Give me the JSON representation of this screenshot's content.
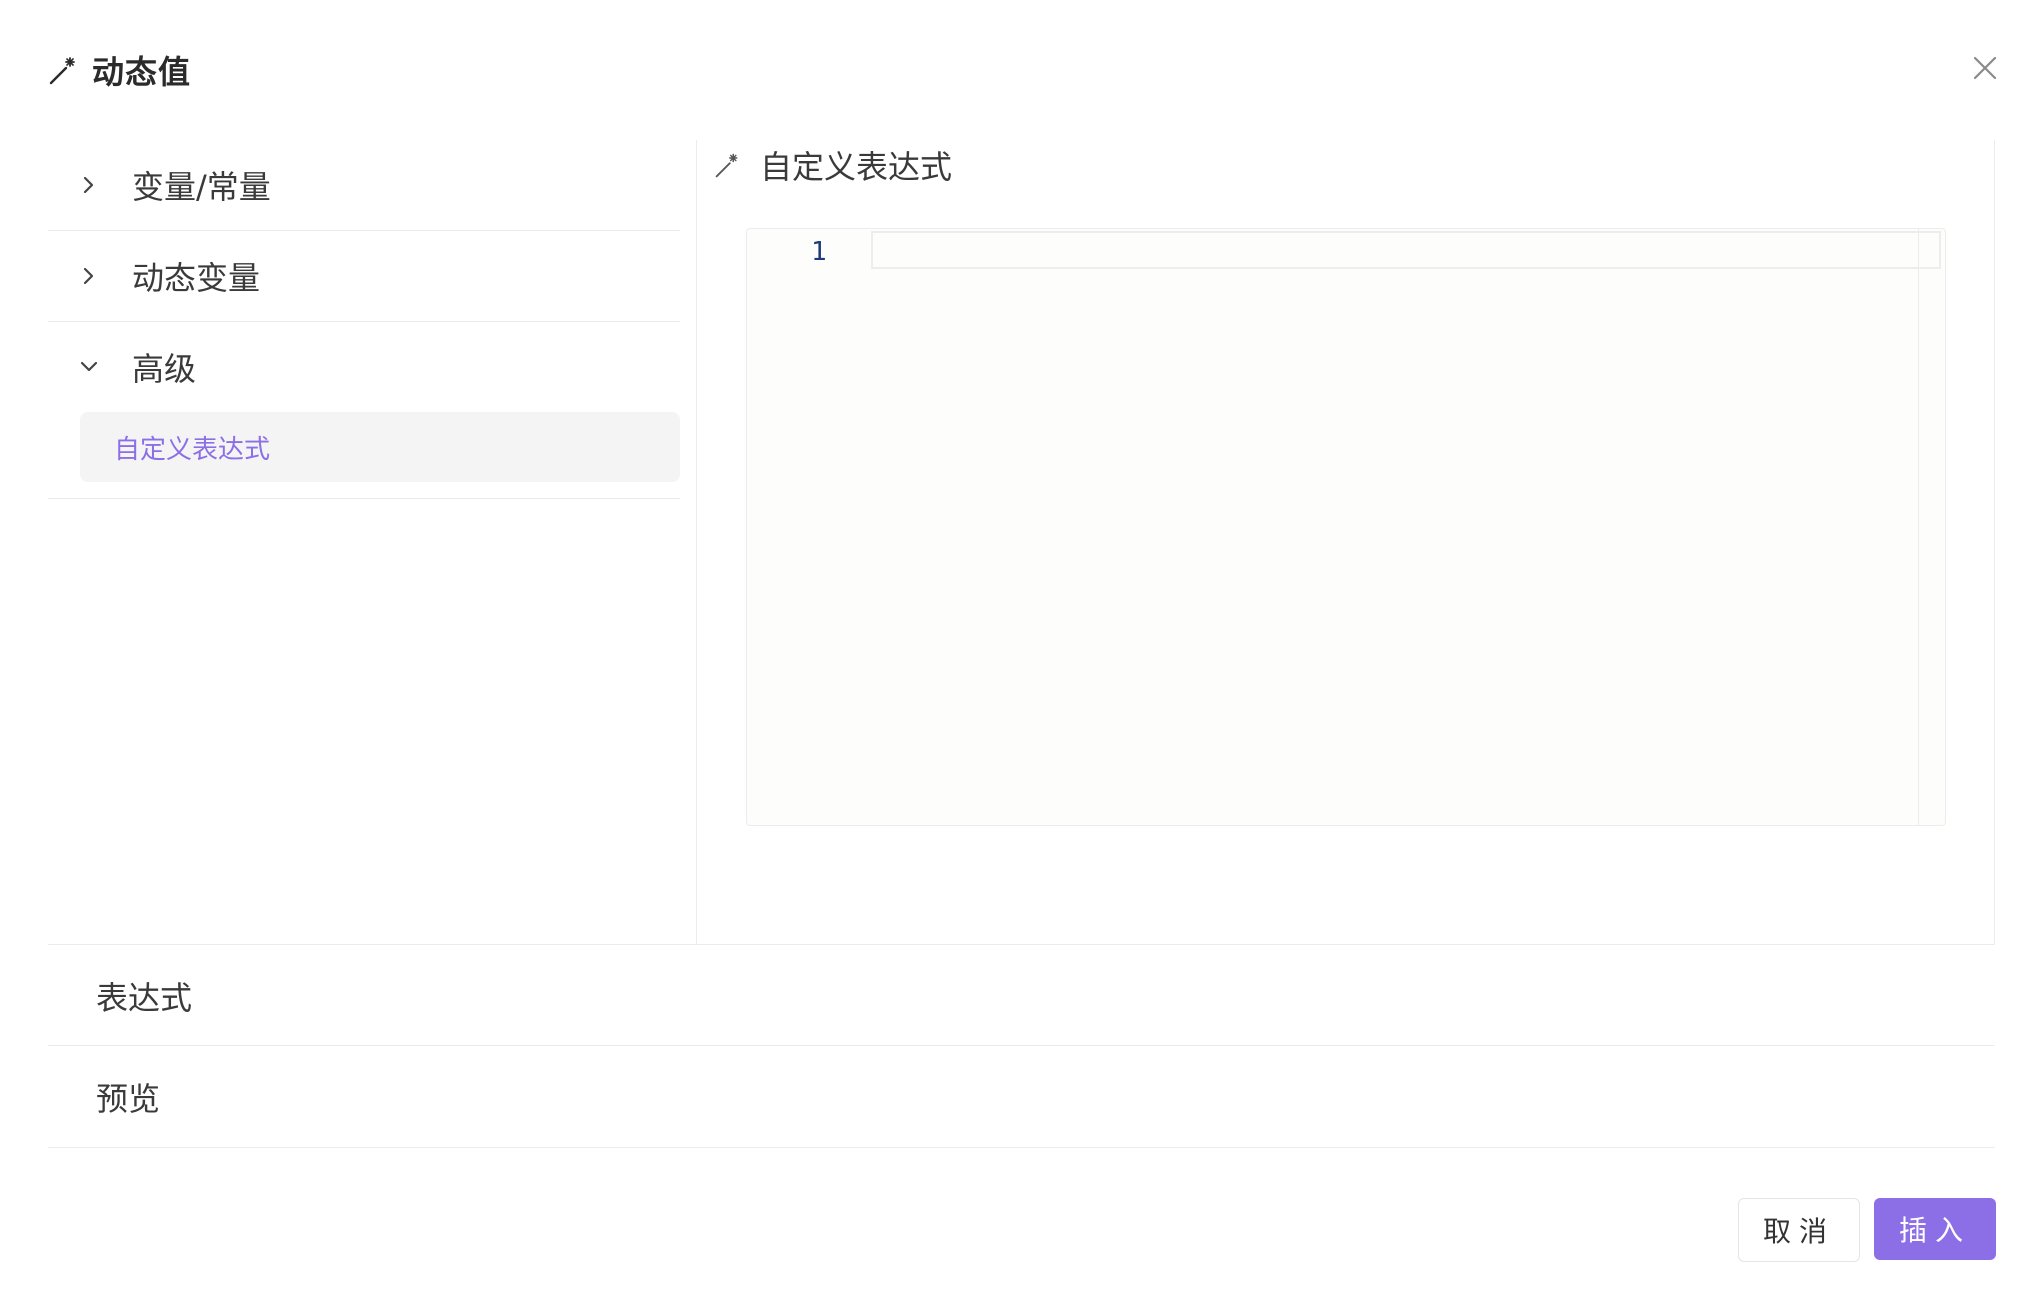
{
  "dialog": {
    "title": "动态值",
    "title_icon": "magic-wand-icon",
    "close_icon": "close-icon"
  },
  "sidebar": {
    "items": [
      {
        "label": "变量/常量",
        "expanded": false,
        "icon": "chevron-right-icon"
      },
      {
        "label": "动态变量",
        "expanded": false,
        "icon": "chevron-right-icon"
      },
      {
        "label": "高级",
        "expanded": true,
        "icon": "chevron-down-icon",
        "children": [
          {
            "label": "自定义表达式",
            "selected": true
          }
        ]
      }
    ]
  },
  "editor_panel": {
    "title": "自定义表达式",
    "title_icon": "magic-wand-icon",
    "line_number": "1",
    "content": ""
  },
  "sections": {
    "expression_label": "表达式",
    "preview_label": "预览"
  },
  "footer": {
    "cancel_label": "取消",
    "insert_label": "插入"
  },
  "colors": {
    "accent": "#8c6fe6",
    "selected_bg": "#f4f4f5",
    "border": "#ececec",
    "line_number": "#1f3a7a"
  }
}
